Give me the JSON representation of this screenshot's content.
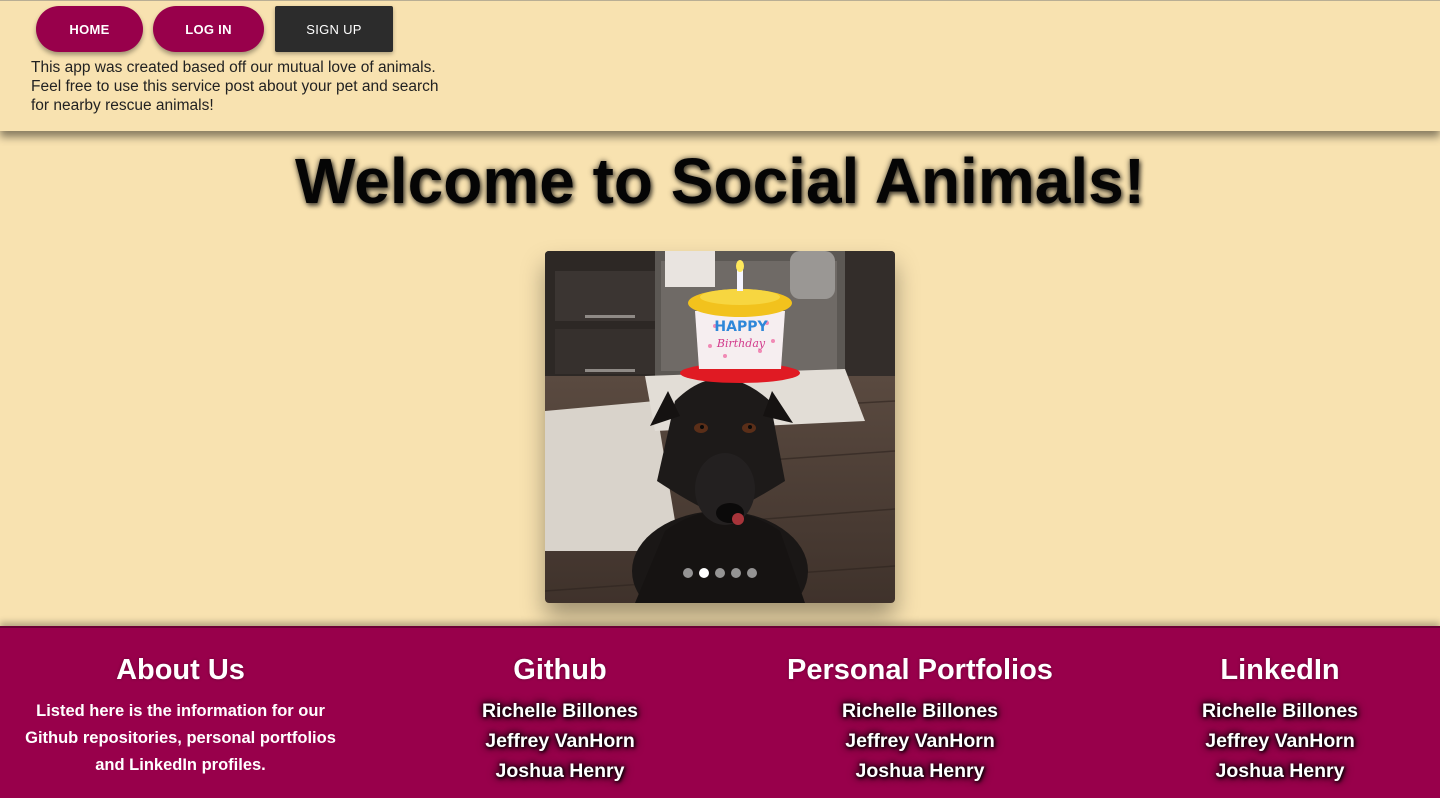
{
  "nav": {
    "home_label": "HOME",
    "login_label": "LOG IN",
    "signup_label": "SIGN UP"
  },
  "intro_text": "This app was created based off our mutual love of animals. Feel free to use this service post about your pet and search for nearby rescue animals!",
  "main": {
    "title": "Welcome to Social Animals!",
    "carousel": {
      "slide_count": 5,
      "active_index": 1,
      "hat_text_1": "HAPPY",
      "hat_text_2": "Birthday"
    }
  },
  "footer": {
    "about": {
      "title": "About Us",
      "text": "Listed here is the information for our Github repositories, personal portfolios and LinkedIn profiles."
    },
    "github": {
      "title": "Github",
      "links": [
        "Richelle Billones",
        "Jeffrey VanHorn",
        "Joshua Henry"
      ]
    },
    "portfolios": {
      "title": "Personal Portfolios",
      "links": [
        "Richelle Billones",
        "Jeffrey VanHorn",
        "Joshua Henry"
      ]
    },
    "linkedin": {
      "title": "LinkedIn",
      "links": [
        "Richelle Billones",
        "Jeffrey VanHorn",
        "Joshua Henry"
      ]
    }
  },
  "colors": {
    "background": "#f8e2b0",
    "brand": "#98004b",
    "dark_button": "#2c2c2c"
  }
}
